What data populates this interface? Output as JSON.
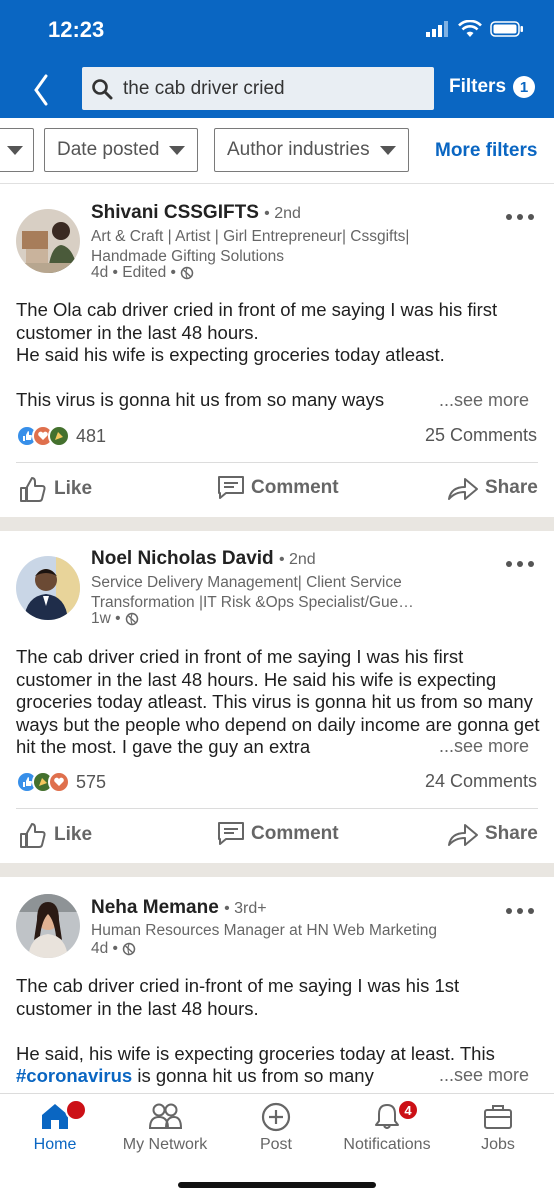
{
  "status_bar": {
    "time": "12:23"
  },
  "search": {
    "query": "the cab driver cried",
    "filters_label": "Filters",
    "filters_count": "1"
  },
  "filter_bar": {
    "date_posted": "Date posted",
    "author_industries": "Author industries",
    "more_filters": "More filters"
  },
  "posts": [
    {
      "author": "Shivani CSSGIFTS",
      "degree": "• 2nd",
      "headline": "Art & Craft | Artist | Girl Entrepreneur| Cssgifts| Handmade Gifting Solutions",
      "meta": "4d • Edited •",
      "text": "The Ola cab driver cried in front of me saying I was his first customer in the last 48 hours.\nHe said his wife is expecting groceries today atleast.\n\nThis virus is gonna hit us from so many ways",
      "see_more": "...see more",
      "reactions": "481",
      "comments": "25 Comments"
    },
    {
      "author": "Noel Nicholas David",
      "degree": "• 2nd",
      "headline": "Service Delivery Management| Client Service Transformation |IT Risk &Ops Specialist/Gue…",
      "meta": "1w •",
      "text": "The cab driver cried in front of me saying I was his first customer in the last 48 hours. He said his wife is expecting groceries today atleast. This virus is gonna hit us from so many ways but the people who depend on daily income are gonna get hit the most. I gave the guy an extra",
      "see_more": "...see more",
      "reactions": "575",
      "comments": "24 Comments"
    },
    {
      "author": "Neha Memane",
      "degree": "• 3rd+",
      "headline": "Human Resources Manager at HN Web Marketing",
      "meta": "4d •",
      "text_a": "The cab driver cried in-front of me saying I was his 1st customer in the last 48 hours.",
      "text_b": "He said, his wife is expecting groceries today at least. This",
      "hashtag": "#coronavirus",
      "text_c": " is gonna hit us from so many",
      "see_more": "...see more"
    }
  ],
  "actions": {
    "like": "Like",
    "comment": "Comment",
    "share": "Share"
  },
  "nav": {
    "home": "Home",
    "network": "My Network",
    "post": "Post",
    "notifications": "Notifications",
    "notifications_badge": "4",
    "jobs": "Jobs"
  },
  "colors": {
    "brand": "#0a66c2",
    "badge": "#cc1016",
    "separator": "#e9e6e1"
  }
}
